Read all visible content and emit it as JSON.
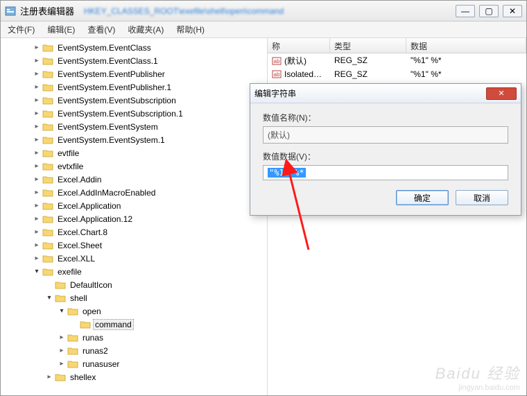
{
  "window": {
    "title": "注册表编辑器",
    "path_blurred": "HKEY_CLASSES_ROOT\\exefile\\shell\\open\\command"
  },
  "win_controls": {
    "min": "—",
    "max": "▢",
    "close": "✕"
  },
  "menu": {
    "file": "文件(F)",
    "edit": "编辑(E)",
    "view": "查看(V)",
    "favorites": "收藏夹(A)",
    "help": "帮助(H)"
  },
  "tree": [
    {
      "indent": 2,
      "arrow": "closed",
      "label": "EventSystem.EventClass"
    },
    {
      "indent": 2,
      "arrow": "closed",
      "label": "EventSystem.EventClass.1"
    },
    {
      "indent": 2,
      "arrow": "closed",
      "label": "EventSystem.EventPublisher"
    },
    {
      "indent": 2,
      "arrow": "closed",
      "label": "EventSystem.EventPublisher.1"
    },
    {
      "indent": 2,
      "arrow": "closed",
      "label": "EventSystem.EventSubscription"
    },
    {
      "indent": 2,
      "arrow": "closed",
      "label": "EventSystem.EventSubscription.1"
    },
    {
      "indent": 2,
      "arrow": "closed",
      "label": "EventSystem.EventSystem"
    },
    {
      "indent": 2,
      "arrow": "closed",
      "label": "EventSystem.EventSystem.1"
    },
    {
      "indent": 2,
      "arrow": "closed",
      "label": "evtfile"
    },
    {
      "indent": 2,
      "arrow": "closed",
      "label": "evtxfile"
    },
    {
      "indent": 2,
      "arrow": "closed",
      "label": "Excel.Addin"
    },
    {
      "indent": 2,
      "arrow": "closed",
      "label": "Excel.AddInMacroEnabled"
    },
    {
      "indent": 2,
      "arrow": "closed",
      "label": "Excel.Application"
    },
    {
      "indent": 2,
      "arrow": "closed",
      "label": "Excel.Application.12"
    },
    {
      "indent": 2,
      "arrow": "closed",
      "label": "Excel.Chart.8"
    },
    {
      "indent": 2,
      "arrow": "closed",
      "label": "Excel.Sheet"
    },
    {
      "indent": 2,
      "arrow": "closed",
      "label": "Excel.XLL"
    },
    {
      "indent": 2,
      "arrow": "open",
      "label": "exefile"
    },
    {
      "indent": 3,
      "arrow": "none",
      "label": "DefaultIcon"
    },
    {
      "indent": 3,
      "arrow": "open",
      "label": "shell"
    },
    {
      "indent": 4,
      "arrow": "open",
      "label": "open"
    },
    {
      "indent": 5,
      "arrow": "none",
      "label": "command",
      "selected": true
    },
    {
      "indent": 4,
      "arrow": "closed",
      "label": "runas"
    },
    {
      "indent": 4,
      "arrow": "closed",
      "label": "runas2"
    },
    {
      "indent": 4,
      "arrow": "closed",
      "label": "runasuser"
    },
    {
      "indent": 3,
      "arrow": "closed",
      "label": "shellex"
    }
  ],
  "list": {
    "headers": {
      "name": "称",
      "type": "类型",
      "data": "数据"
    },
    "rows": [
      {
        "name": "(默认)",
        "type": "REG_SZ",
        "data": "\"%1\" %*"
      },
      {
        "name": "IsolatedComm...",
        "type": "REG_SZ",
        "data": "\"%1\" %*"
      }
    ]
  },
  "dialog": {
    "title": "编辑字符串",
    "name_label": "数值名称(N)：",
    "name_value": "(默认)",
    "data_label": "数值数据(V)：",
    "data_value": "\"%1\" %*",
    "ok": "确定",
    "cancel": "取消",
    "close": "✕"
  },
  "watermark": {
    "brand": "Baidu 经验",
    "url": "jingyan.baidu.com"
  },
  "icons": {
    "folder_fill": "#f7d774",
    "folder_stroke": "#c9a227"
  }
}
